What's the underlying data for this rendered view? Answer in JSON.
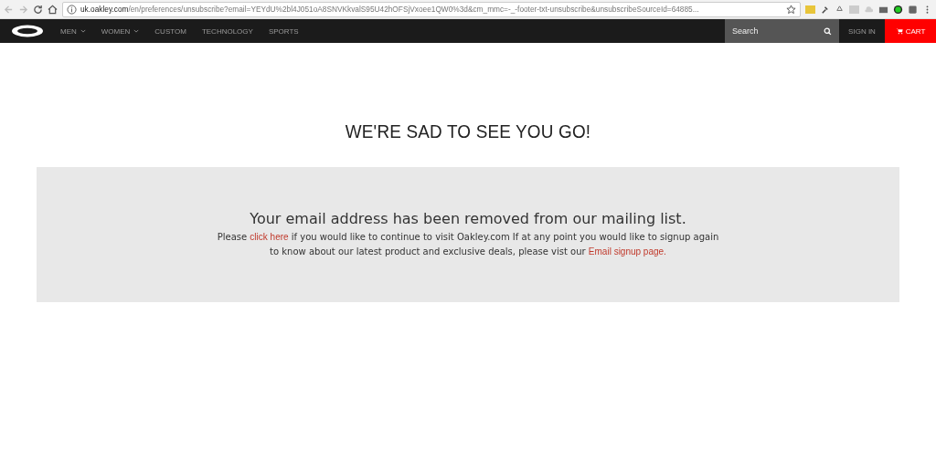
{
  "browser": {
    "url_host": "uk.oakley.com",
    "url_rest": "/en/preferences/unsubscribe?email=YEYdU%2bl4J051oA8SNVKkvalS95U42hOFSjVxoee1QW0%3d&cm_mmc=-_-footer-txt-unsubscribe&unsubscribeSourceId=64885..."
  },
  "nav": {
    "items": [
      {
        "label": "MEN",
        "dropdown": true
      },
      {
        "label": "WOMEN",
        "dropdown": true
      },
      {
        "label": "CUSTOM",
        "dropdown": false
      },
      {
        "label": "TECHNOLOGY",
        "dropdown": false
      },
      {
        "label": "SPORTS",
        "dropdown": false
      }
    ],
    "search": {
      "placeholder": "Search"
    },
    "sign_in": "SIGN IN",
    "cart": "CART"
  },
  "heading": "WE'RE SAD TO SEE YOU GO!",
  "message": {
    "title": "Your email address has been removed from our mailing list.",
    "parts": [
      {
        "kind": "text",
        "text": "Please "
      },
      {
        "kind": "link",
        "text": "click here"
      },
      {
        "kind": "text",
        "text": " if you would like to continue to visit Oakley.com If at any point you would like to signup again to know about our latest product and exclusive deals, please vist our "
      },
      {
        "kind": "link",
        "text": "Email signup page."
      }
    ]
  }
}
